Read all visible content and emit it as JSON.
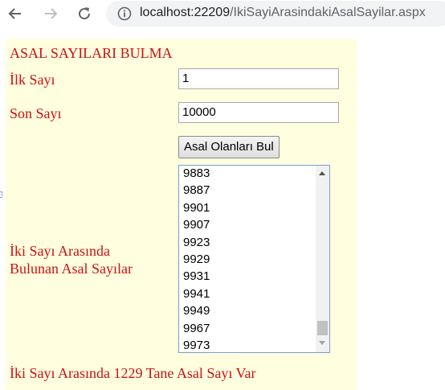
{
  "browser": {
    "back_icon": "arrow-left-icon",
    "forward_icon": "arrow-right-icon",
    "reload_icon": "reload-icon",
    "info_icon": "info-icon",
    "url_host": "localhost:22209",
    "url_path": "/IkiSayiArasindakiAsalSayilar.aspx"
  },
  "page": {
    "heading": "ASAL SAYILARI BULMA",
    "first_label": "İlk Sayı",
    "first_value": "1",
    "last_label": "Son Sayı",
    "last_value": "10000",
    "find_button": "Asal Olanları Bul",
    "found_label_line1": "İki Sayı Arasında",
    "found_label_line2": "Bulunan Asal Sayılar",
    "primes": [
      "9883",
      "9887",
      "9901",
      "9907",
      "9923",
      "9929",
      "9931",
      "9941",
      "9949",
      "9967",
      "9973"
    ],
    "summary": "İki Sayı Arasında 1229 Tane Asal Sayı Var"
  },
  "colors": {
    "label_red": "#cc1111",
    "panel_bg": "#ffffe0"
  }
}
